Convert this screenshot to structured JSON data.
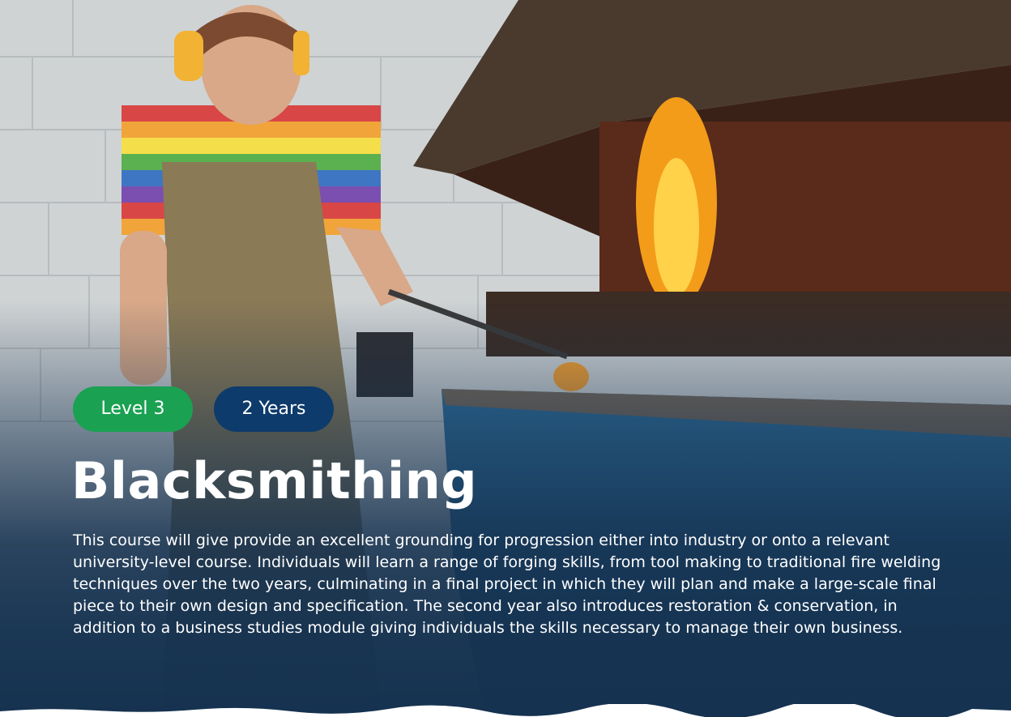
{
  "course": {
    "level": "Level 3",
    "duration": "2 Years",
    "title": "Blacksmithing",
    "description": "This course will give provide an excellent grounding for progression either into industry or onto a relevant university-level course. Individuals will learn a range of forging skills, from tool making to traditional fire welding techniques over the two years, culminating in a final project in which they will plan and make a large-scale final piece to their own design and specification. The second year also introduces restoration & conservation, in addition to a business studies module giving individuals the skills necessary to manage their own business."
  },
  "colors": {
    "level_badge": "#1aa152",
    "duration_badge": "#0d3b6b",
    "panel": "#153250",
    "text": "#ffffff"
  }
}
